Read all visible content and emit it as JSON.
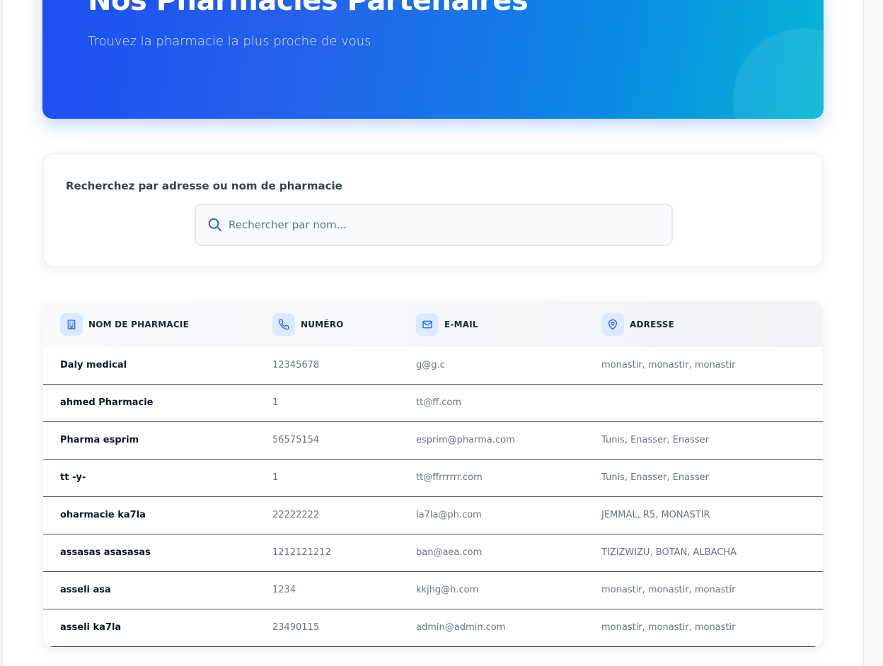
{
  "hero": {
    "title": "Nos Pharmacies Partenaires",
    "subtitle": "Trouvez la pharmacie la plus proche de vous"
  },
  "search": {
    "label": "Recherchez par adresse ou nom de pharmacie",
    "placeholder": "Rechercher par nom...",
    "value": ""
  },
  "table": {
    "headers": [
      {
        "label": "NOM DE PHARMACIE",
        "icon": "building-icon"
      },
      {
        "label": "NUMÉRO",
        "icon": "phone-icon"
      },
      {
        "label": "E-MAIL",
        "icon": "mail-icon"
      },
      {
        "label": "ADRESSE",
        "icon": "map-pin-icon"
      }
    ],
    "rows": [
      {
        "name": "Daly medical",
        "number": "12345678",
        "email": "g@g.c",
        "address": "monastir, monastir, monastir"
      },
      {
        "name": "ahmed Pharmacie",
        "number": "1",
        "email": "tt@ff.com",
        "address": ""
      },
      {
        "name": "Pharma esprim",
        "number": "56575154",
        "email": "esprim@pharma.com",
        "address": "Tunis, Enasser, Enasser"
      },
      {
        "name": "tt -y-",
        "number": "1",
        "email": "tt@ffrrrrrr.com",
        "address": "Tunis, Enasser, Enasser"
      },
      {
        "name": "oharmacie ka7la",
        "number": "22222222",
        "email": "la7la@ph.com",
        "address": "JEMMAL, R5, MONASTIR"
      },
      {
        "name": "assasas asasasas",
        "number": "1212121212",
        "email": "ban@aea.com",
        "address": "TIZIZWIZU, BOTAN, ALBACHA"
      },
      {
        "name": "asseli asa",
        "number": "1234",
        "email": "kkjhg@h.com",
        "address": "monastir, monastir, monastir"
      },
      {
        "name": "asseli ka7la",
        "number": "23490115",
        "email": "admin@admin.com",
        "address": "monastir, monastir, monastir"
      }
    ]
  },
  "colors": {
    "accent": "#2563eb",
    "hero_gradient_end": "#06b6d4",
    "icon_bg": "#dbeafe"
  }
}
